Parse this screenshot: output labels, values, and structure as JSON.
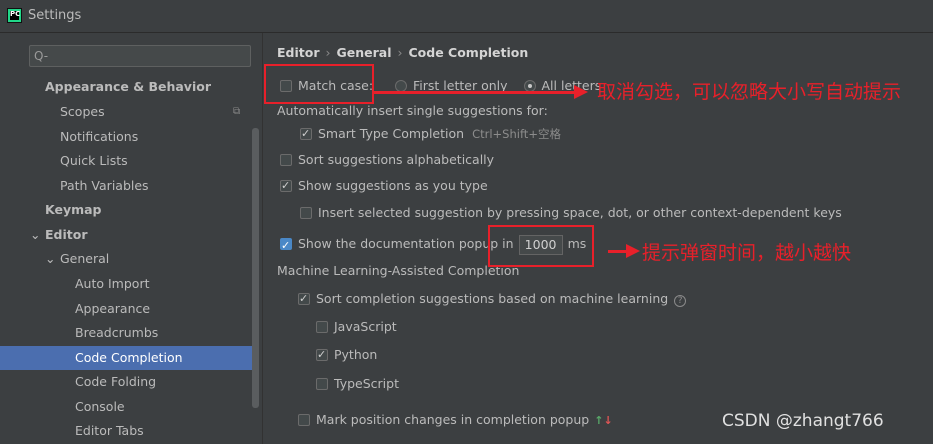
{
  "window": {
    "title": "Settings",
    "app_icon_text": "PC"
  },
  "search": {
    "icon": "search-icon",
    "placeholder": "Q-"
  },
  "sidebar": {
    "items": [
      {
        "label": "Appearance & Behavior",
        "level": 0,
        "bold": true
      },
      {
        "label": "Scopes",
        "level": 1
      },
      {
        "label": "Notifications",
        "level": 1
      },
      {
        "label": "Quick Lists",
        "level": 1
      },
      {
        "label": "Path Variables",
        "level": 1
      },
      {
        "label": "Keymap",
        "level": 0,
        "bold": true
      },
      {
        "label": "Editor",
        "level": 0,
        "bold": true,
        "expanded": true
      },
      {
        "label": "General",
        "level": 1,
        "expanded": true
      },
      {
        "label": "Auto Import",
        "level": 2
      },
      {
        "label": "Appearance",
        "level": 2
      },
      {
        "label": "Breadcrumbs",
        "level": 2
      },
      {
        "label": "Code Completion",
        "level": 2,
        "selected": true
      },
      {
        "label": "Code Folding",
        "level": 2
      },
      {
        "label": "Console",
        "level": 2
      },
      {
        "label": "Editor Tabs",
        "level": 2
      }
    ]
  },
  "breadcrumb": {
    "part1": "Editor",
    "part2": "General",
    "part3": "Code Completion",
    "sep": "›"
  },
  "options": {
    "match_case": "Match case:",
    "first_letter_only": "First letter only",
    "all_letters": "All letters",
    "auto_insert_header": "Automatically insert single suggestions for:",
    "smart_type": "Smart Type Completion",
    "smart_type_shortcut": "Ctrl+Shift+空格",
    "sort_alpha": "Sort suggestions alphabetically",
    "show_as_you_type": "Show suggestions as you type",
    "insert_selected": "Insert selected suggestion by pressing space, dot, or other context-dependent keys",
    "show_doc_popup": "Show the documentation popup in",
    "doc_popup_ms_value": "1000",
    "ms_unit": "ms",
    "ml_header": "Machine Learning-Assisted Completion",
    "ml_sort": "Sort completion suggestions based on machine learning",
    "help_glyph": "?",
    "lang_js": "JavaScript",
    "lang_python": "Python",
    "lang_ts": "TypeScript",
    "mark_position": "Mark position changes in completion popup",
    "arrow_up": "↑",
    "arrow_down": "↓"
  },
  "annotations": {
    "match_case_note": "取消勾选，可以忽略大小写自动提示",
    "popup_note": "提示弹窗时间，越小越快",
    "color": "#e8202a"
  },
  "watermark": "CSDN @zhangt766"
}
